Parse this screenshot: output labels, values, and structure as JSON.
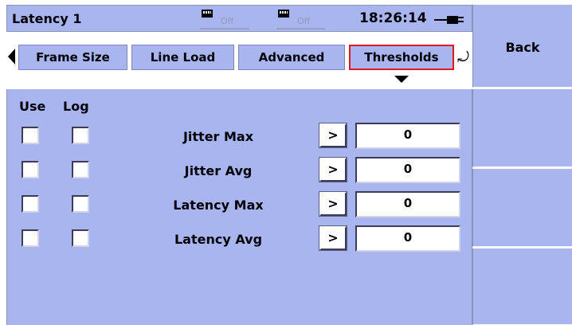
{
  "header": {
    "title": "Latency 1",
    "port1_status": "Off",
    "port2_status": "Off",
    "clock": "18:26:14",
    "port1_icon": "ethernet-port-icon",
    "port2_icon": "ethernet-port-icon",
    "power_icon": "ac-power-plug-icon"
  },
  "tabs": {
    "left_icon": "arrow-left-icon",
    "cycle_icon": "cycle-arrow-icon",
    "items": [
      {
        "label": "Frame Size"
      },
      {
        "label": "Line Load"
      },
      {
        "label": "Advanced"
      },
      {
        "label": "Thresholds",
        "active": true
      }
    ]
  },
  "thresholds": {
    "col_use": "Use",
    "col_log": "Log",
    "rows": [
      {
        "label": "Jitter Max",
        "use": false,
        "log": false,
        "edit": ">",
        "value": "0"
      },
      {
        "label": "Jitter Avg",
        "use": false,
        "log": false,
        "edit": ">",
        "value": "0"
      },
      {
        "label": "Latency Max",
        "use": false,
        "log": false,
        "edit": ">",
        "value": "0"
      },
      {
        "label": "Latency Avg",
        "use": false,
        "log": false,
        "edit": ">",
        "value": "0"
      }
    ]
  },
  "softkeys": {
    "back": "Back"
  },
  "colors": {
    "panel": "#a9b5ee",
    "active_tab_border": "#e0181e",
    "field": "#ffffff"
  }
}
